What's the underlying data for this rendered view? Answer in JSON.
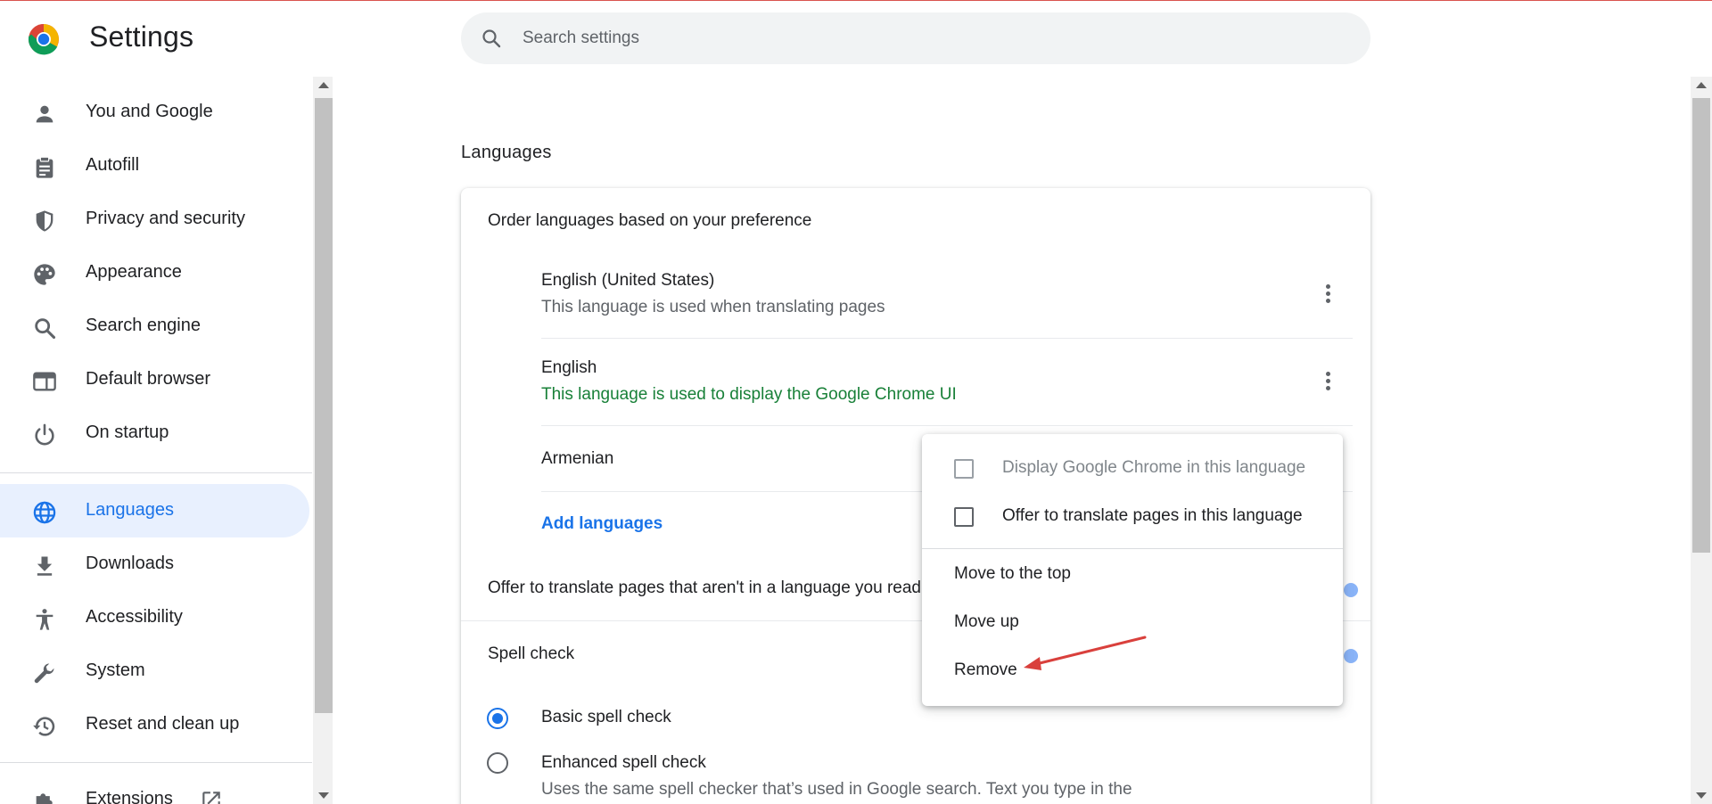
{
  "app": {
    "title": "Settings",
    "logo_icon": "chrome-logo-icon"
  },
  "search": {
    "placeholder": "Search settings",
    "icon": "search-icon"
  },
  "sidebar": {
    "items": [
      {
        "label": "You and Google",
        "icon": "person-icon"
      },
      {
        "label": "Autofill",
        "icon": "clipboard-icon"
      },
      {
        "label": "Privacy and security",
        "icon": "shield-icon"
      },
      {
        "label": "Appearance",
        "icon": "palette-icon"
      },
      {
        "label": "Search engine",
        "icon": "search-icon"
      },
      {
        "label": "Default browser",
        "icon": "browser-window-icon"
      },
      {
        "label": "On startup",
        "icon": "power-icon"
      },
      {
        "label": "Languages",
        "icon": "globe-icon",
        "active": true
      },
      {
        "label": "Downloads",
        "icon": "download-icon"
      },
      {
        "label": "Accessibility",
        "icon": "accessibility-icon"
      },
      {
        "label": "System",
        "icon": "wrench-icon"
      },
      {
        "label": "Reset and clean up",
        "icon": "history-icon"
      },
      {
        "label": "Extensions",
        "icon": "puzzle-icon",
        "external_icon": "open-in-new-icon"
      }
    ]
  },
  "main": {
    "section_title": "Languages",
    "order_title": "Order languages based on your preference",
    "languages": [
      {
        "name": "English (United States)",
        "note": "This language is used when translating pages"
      },
      {
        "name": "English",
        "note": "This language is used to display the Google Chrome UI"
      },
      {
        "name": "Armenian"
      }
    ],
    "add_languages": "Add languages",
    "translate_offer": "Offer to translate pages that aren't in a language you read",
    "spell_check": {
      "title": "Spell check",
      "basic": "Basic spell check",
      "enhanced": "Enhanced spell check",
      "enhanced_note": "Uses the same spell checker that’s used in Google search. Text you type in the"
    }
  },
  "context_menu": {
    "display_option": "Display Google Chrome in this language",
    "translate_option": "Offer to translate pages in this language",
    "move_top": "Move to the top",
    "move_up": "Move up",
    "remove": "Remove"
  },
  "colors": {
    "accent": "#1a73e8",
    "active_bg": "#e8f0fe",
    "green_note": "#188038",
    "annotation_arrow": "#d9403c"
  }
}
